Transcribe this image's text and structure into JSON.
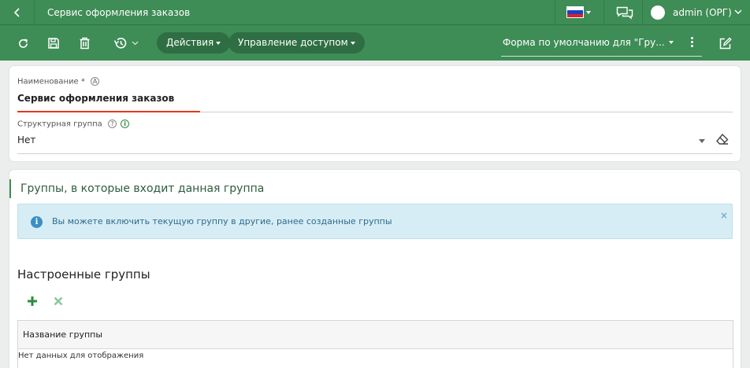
{
  "topbar": {
    "title": "Сервис оформления заказов",
    "user": "admin (ОРГ)"
  },
  "toolbar": {
    "actions_label": "Действия",
    "access_label": "Управление доступом",
    "form_select": "Форма по умолчанию для \"Гру..."
  },
  "form": {
    "name_label": "Наименование",
    "name_required": "*",
    "name_badge": "A",
    "name_value": "Сервис оформления заказов",
    "group_label": "Структурная группа",
    "group_help": "?",
    "group_info": "i",
    "group_value": "Нет"
  },
  "groups_section": {
    "title": "Группы, в которые входит данная группа",
    "info_icon": "i",
    "info_text": "Вы можете включить текущую группу в другие, ранее созданные группы",
    "info_close": "×",
    "subtitle": "Настроенные группы",
    "column_header": "Название группы",
    "empty_text": "Нет данных для отображения"
  },
  "colors": {
    "brand_green": "#3e8c56",
    "pill_dark": "#2e6e42",
    "required_red": "#e8361e",
    "info_bg": "#d7edf5"
  },
  "icons": [
    "chevron-left-icon",
    "flag-ru-icon",
    "chat-icon",
    "avatar",
    "chevron-down-icon",
    "refresh-icon",
    "save-icon",
    "trash-icon",
    "history-icon",
    "kebab-icon",
    "edit-icon",
    "eraser-icon",
    "info-icon",
    "plus-icon",
    "close-x-icon"
  ]
}
